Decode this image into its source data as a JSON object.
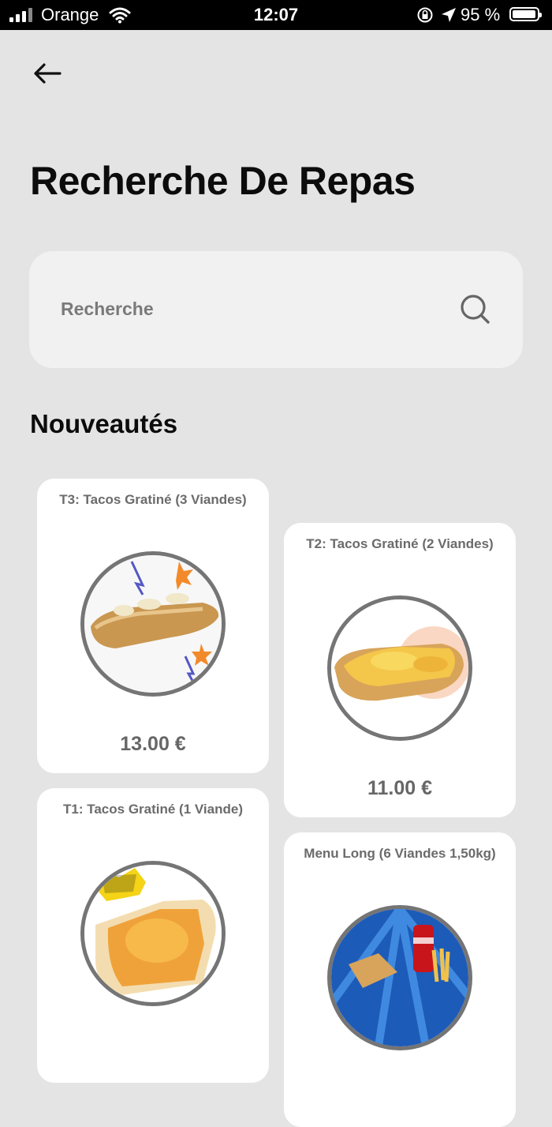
{
  "status_bar": {
    "carrier": "Orange",
    "time": "12:07",
    "battery": "95 %"
  },
  "header": {
    "back_icon": "arrow-left-icon",
    "title": "Recherche De Repas"
  },
  "search": {
    "placeholder": "Recherche",
    "icon": "search-icon"
  },
  "section": {
    "title": "Nouveautés"
  },
  "products": [
    {
      "name": "T3: Tacos Gratiné (3 Viandes)",
      "price": "13.00 €"
    },
    {
      "name": "T2: Tacos Gratiné (2 Viandes)",
      "price": "11.00 €"
    },
    {
      "name": "T1: Tacos Gratiné (1 Viande)",
      "price": ""
    },
    {
      "name": "Menu Long (6 Viandes 1,50kg)",
      "price": ""
    }
  ]
}
